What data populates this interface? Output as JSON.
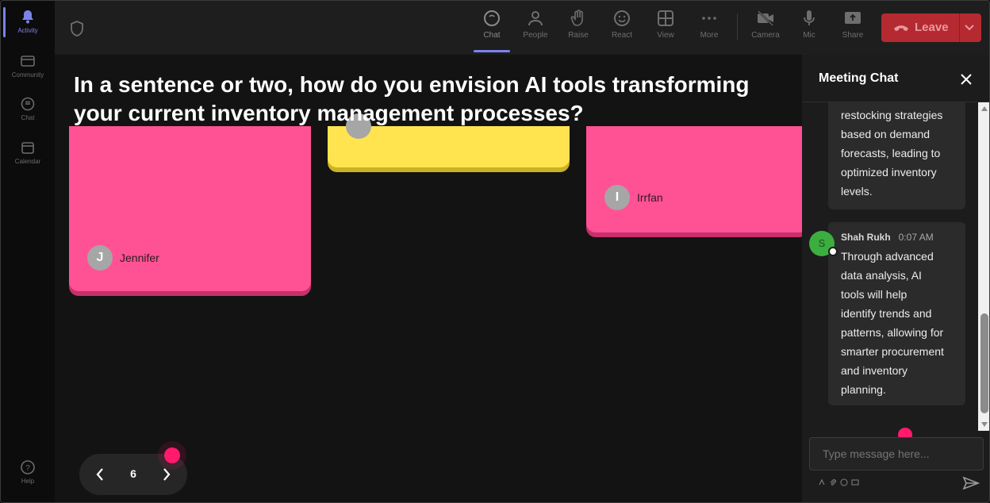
{
  "rail": {
    "items": [
      {
        "label": "Activity",
        "icon": "bell-icon",
        "active": true
      },
      {
        "label": "Community",
        "icon": "community-icon",
        "active": false
      },
      {
        "label": "Chat",
        "icon": "chat-icon",
        "active": false
      },
      {
        "label": "Calendar",
        "icon": "calendar-icon",
        "active": false
      }
    ],
    "help": {
      "label": "Help",
      "icon": "help-icon"
    }
  },
  "toolbar": {
    "buttons": [
      {
        "label": "Chat",
        "icon": "chat-icon",
        "active": true
      },
      {
        "label": "People",
        "icon": "people-icon"
      },
      {
        "label": "Raise",
        "icon": "hand-icon"
      },
      {
        "label": "React",
        "icon": "smiley-icon"
      },
      {
        "label": "View",
        "icon": "grid-icon"
      },
      {
        "label": "More",
        "icon": "more-icon"
      },
      {
        "label": "Camera",
        "icon": "camera-off-icon"
      },
      {
        "label": "Mic",
        "icon": "mic-icon"
      },
      {
        "label": "Share",
        "icon": "share-icon"
      }
    ],
    "leave_label": "Leave",
    "accent_color": "#7b83eb",
    "leave_color": "#b52a30"
  },
  "stage": {
    "question": "In a sentence or two, how do you envision AI tools transforming your current inventory management processes?",
    "notes": [
      {
        "author": "Jennifer",
        "initial": "J",
        "color": "#ff5294"
      },
      {
        "author": "",
        "initial": "",
        "color": "#ffe44f"
      },
      {
        "author": "Irrfan",
        "initial": "I",
        "color": "#ff5294"
      }
    ],
    "pager": {
      "page": "6"
    }
  },
  "chat": {
    "title": "Meeting Chat",
    "messages": [
      {
        "sender": "",
        "time": "",
        "lines": [
          "restocking strategies",
          "based on demand",
          "forecasts, leading to",
          "optimized inventory",
          "levels."
        ]
      },
      {
        "sender": "Shah Rukh",
        "initial": "S",
        "time": "0:07 AM",
        "lines": [
          "Through advanced",
          "data analysis, AI",
          "tools will help",
          "identify trends and",
          "patterns, allowing for",
          "smarter procurement",
          "and inventory",
          "planning."
        ]
      }
    ],
    "input_placeholder": "Type message here..."
  }
}
